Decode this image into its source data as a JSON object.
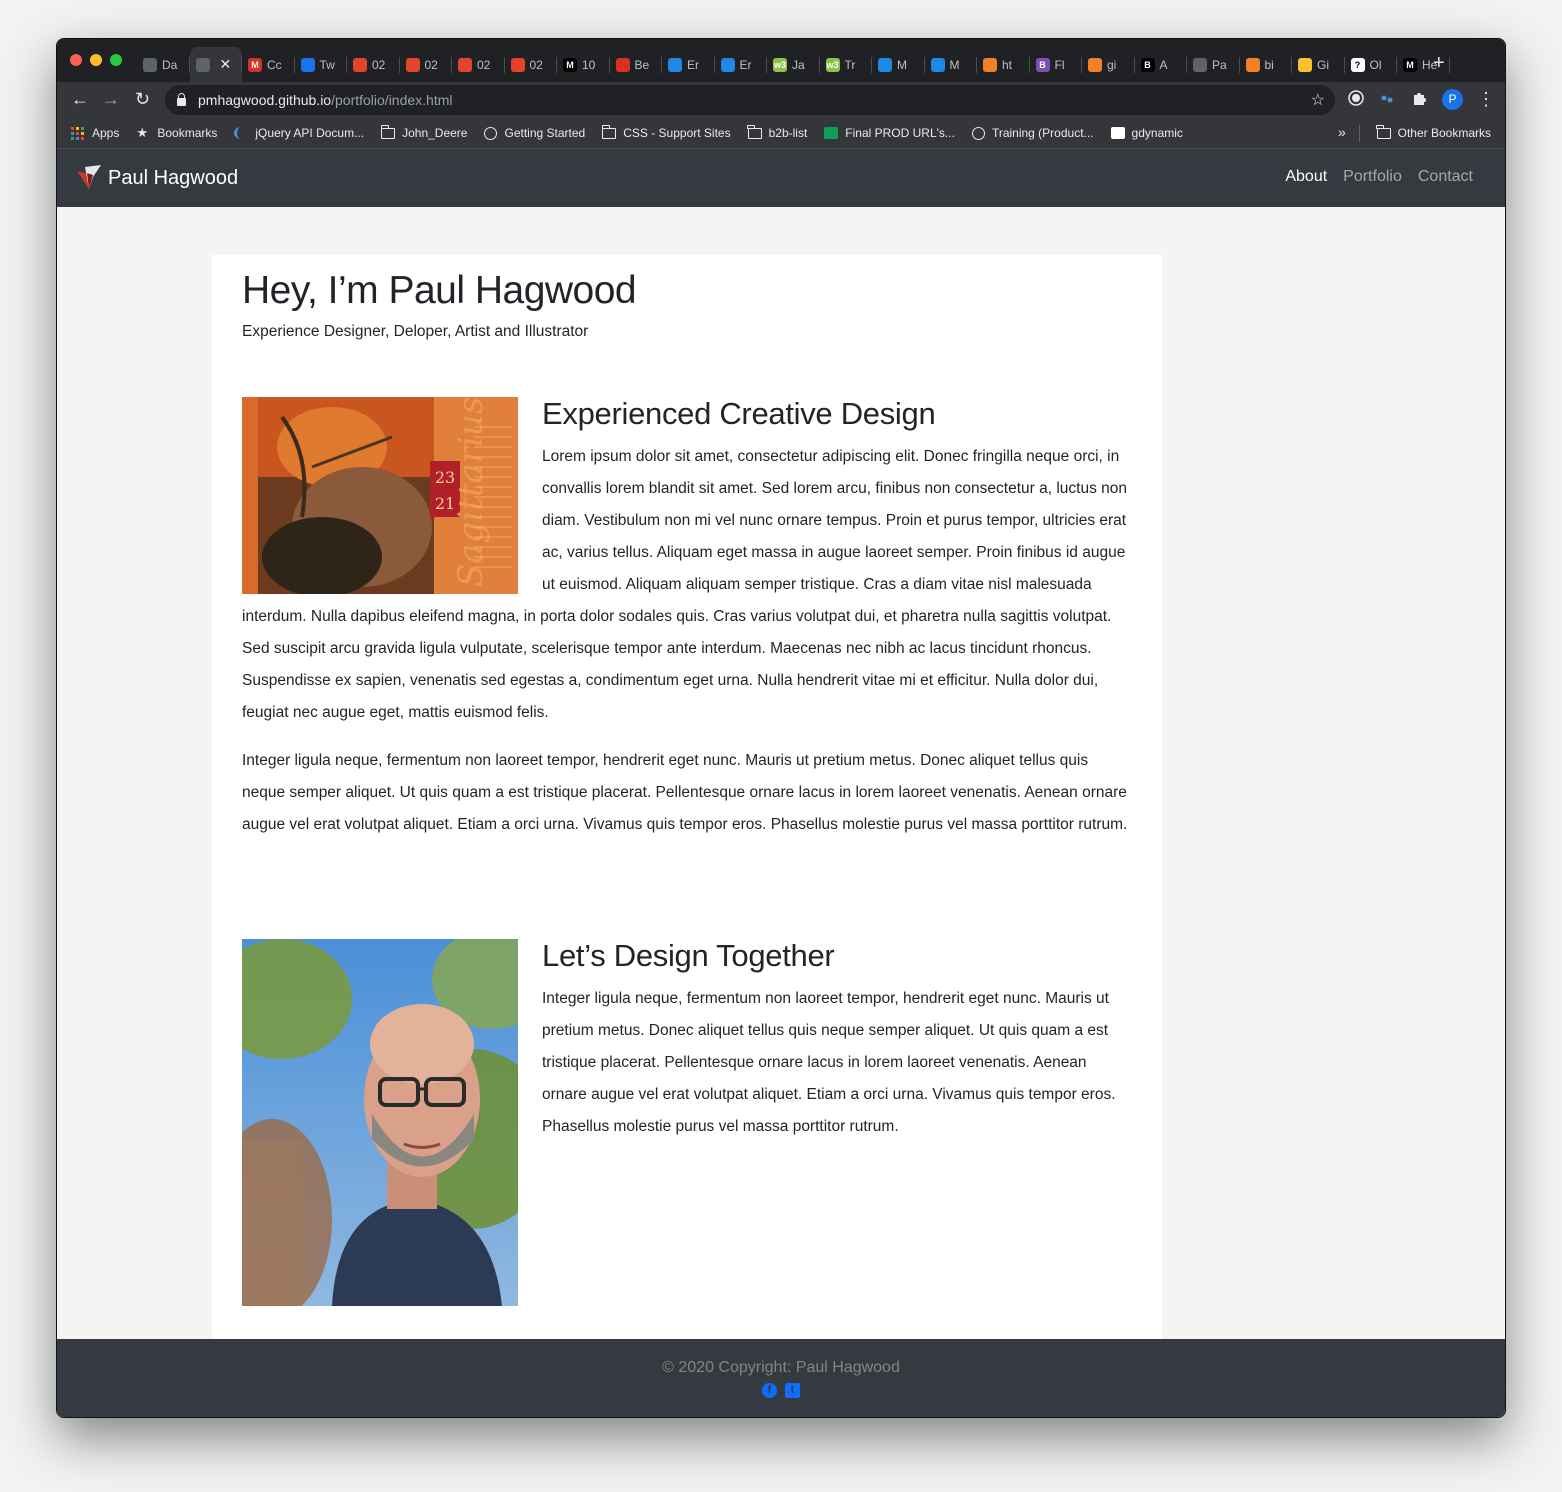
{
  "browser": {
    "tabs": [
      {
        "label": "Da",
        "color": "#5f6368"
      },
      {
        "label": "",
        "color": "#5f6368",
        "active": true
      },
      {
        "label": "Cc",
        "color": "#d93025",
        "icon": "M"
      },
      {
        "label": "Tw",
        "color": "#1a73e8"
      },
      {
        "label": "02",
        "color": "#e24329"
      },
      {
        "label": "02",
        "color": "#e24329"
      },
      {
        "label": "02",
        "color": "#e24329"
      },
      {
        "label": "02",
        "color": "#e24329"
      },
      {
        "label": "10",
        "color": "#000000",
        "icon": "M"
      },
      {
        "label": "Be",
        "color": "#d93025"
      },
      {
        "label": "Er",
        "color": "#1e88e5"
      },
      {
        "label": "Er",
        "color": "#1e88e5"
      },
      {
        "label": "Ja",
        "color": "#8bc34a",
        "icon": "w3"
      },
      {
        "label": "Tr",
        "color": "#8bc34a",
        "icon": "w3"
      },
      {
        "label": "M",
        "color": "#1e88e5"
      },
      {
        "label": "M",
        "color": "#1e88e5"
      },
      {
        "label": "ht",
        "color": "#f48024"
      },
      {
        "label": "Fl",
        "color": "#7952b3",
        "icon": "B"
      },
      {
        "label": "gi",
        "color": "#f48024"
      },
      {
        "label": "A",
        "color": "#000000",
        "icon": "B"
      },
      {
        "label": "Pa",
        "color": "#5f6368"
      },
      {
        "label": "bi",
        "color": "#f48024"
      },
      {
        "label": "Gi",
        "color": "#fbc02d"
      },
      {
        "label": "Ol",
        "color": "#ffffff",
        "icon": "?"
      },
      {
        "label": "He",
        "color": "#000000",
        "icon": "M"
      }
    ],
    "new_tab": "+",
    "back": "←",
    "forward": "→",
    "reload": "↻",
    "url_host": "pmhagwood.github.io",
    "url_path": "/portfolio/index.html",
    "star": "☆",
    "profile_initial": "P",
    "menu": "⋮",
    "bookmarks": [
      {
        "label": "Apps",
        "icon": "apps-icon"
      },
      {
        "label": "Bookmarks",
        "icon": "star-icon"
      },
      {
        "label": "jQuery API Docum...",
        "icon": "jquery-icon"
      },
      {
        "label": "John_Deere",
        "icon": "folder-icon"
      },
      {
        "label": "Getting Started",
        "icon": "globe-icon"
      },
      {
        "label": "CSS - Support Sites",
        "icon": "folder-icon"
      },
      {
        "label": "b2b-list",
        "icon": "folder-icon"
      },
      {
        "label": "Final PROD URL's...",
        "icon": "sheets-icon"
      },
      {
        "label": "Training (Product...",
        "icon": "globe-icon"
      },
      {
        "label": "gdynamic",
        "icon": "doc-icon"
      }
    ],
    "more_bookmarks": "»",
    "other_bookmarks": "Other Bookmarks"
  },
  "site": {
    "brand": "Paul Hagwood",
    "nav": [
      {
        "label": "About",
        "active": true
      },
      {
        "label": "Portfolio"
      },
      {
        "label": "Contact"
      }
    ],
    "hero_title": "Hey, I’m Paul Hagwood",
    "hero_subtitle": "Experience Designer, Deloper, Artist and Illustrator",
    "section1": {
      "title": "Experienced Creative Design",
      "p1": "Lorem ipsum dolor sit amet, consectetur adipiscing elit. Donec fringilla neque orci, in convallis lorem blandit sit amet. Sed lorem arcu, finibus non consectetur a, luctus non diam. Vestibulum non mi vel nunc ornare tempus. Proin et purus tempor, ultricies erat ac, varius tellus. Aliquam eget massa in augue laoreet semper. Proin finibus id augue ut euismod. Aliquam aliquam semper tristique. Cras a diam vitae nisl malesuada interdum. Nulla dapibus eleifend magna, in porta dolor sodales quis. Cras varius volutpat dui, et pharetra nulla sagittis volutpat. Sed suscipit arcu gravida ligula vulputate, scelerisque tempor ante interdum. Maecenas nec nibh ac lacus tincidunt rhoncus. Suspendisse ex sapien, venenatis sed egestas a, condimentum eget urna. Nulla hendrerit vitae mi et efficitur. Nulla dolor dui, feugiat nec augue eget, mattis euismod felis.",
      "p2": "Integer ligula neque, fermentum non laoreet tempor, hendrerit eget nunc. Mauris ut pretium metus. Donec aliquet tellus quis neque semper aliquet. Ut quis quam a est tristique placerat. Pellentesque ornare lacus in lorem laoreet venenatis. Aenean ornare augue vel erat volutpat aliquet. Etiam a orci urna. Vivamus quis tempor eros. Phasellus molestie purus vel massa porttitor rutrum.",
      "poster_top": "23",
      "poster_bottom": "21",
      "poster_side": "Sagittarius"
    },
    "section2": {
      "title": "Let’s Design Together",
      "p1": "Integer ligula neque, fermentum non laoreet tempor, hendrerit eget nunc. Mauris ut pretium metus. Donec aliquet tellus quis neque semper aliquet. Ut quis quam a est tristique placerat. Pellentesque ornare lacus in lorem laoreet venenatis. Aenean ornare augue vel erat volutpat aliquet. Etiam a orci urna. Vivamus quis tempor eros. Phasellus molestie purus vel massa porttitor rutrum."
    },
    "footer": {
      "copyright": "© 2020 Copyright: Paul Hagwood",
      "facebook_icon": "f",
      "twitter_icon": "t"
    }
  }
}
